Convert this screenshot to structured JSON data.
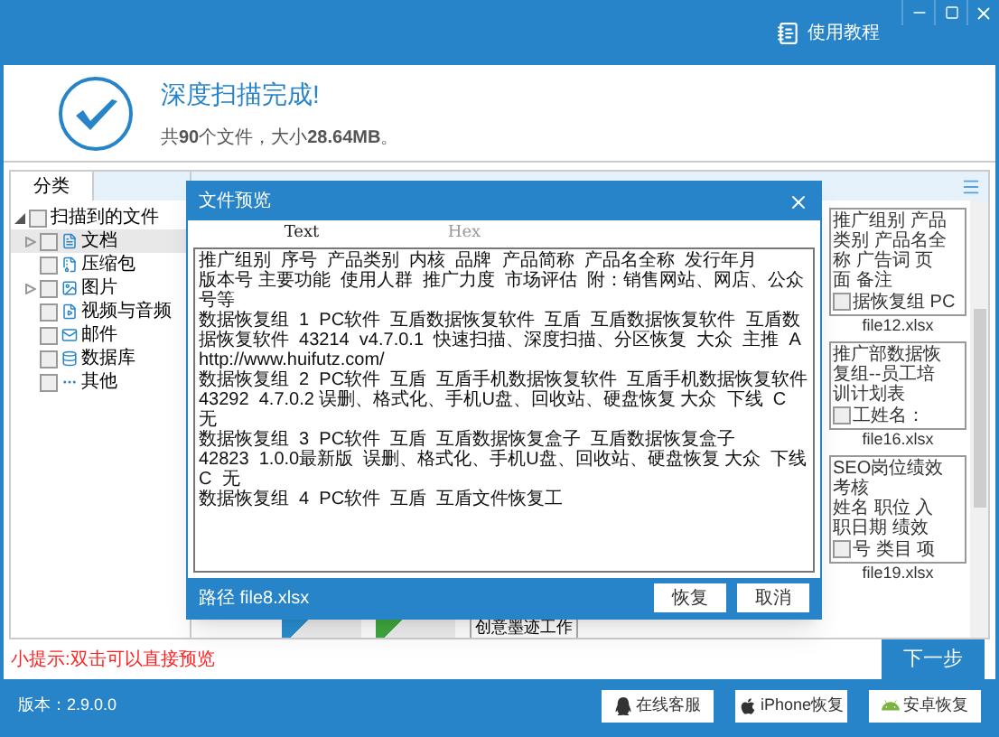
{
  "toolbar": {
    "help": "使用教程"
  },
  "summary": {
    "title": "深度扫描完成!",
    "detail": "共**90**个文件，大小**28.64MB**。"
  },
  "sidebar": {
    "tab": "分类",
    "root": {
      "label": "扫描到的文件",
      "checked": false,
      "expanded": true,
      "children": [
        {
          "label": "文档",
          "kind": "doc",
          "checked": false,
          "expanded": false,
          "selected": true
        },
        {
          "label": "压缩包",
          "kind": "zip",
          "checked": false,
          "selected": false
        },
        {
          "label": "图片",
          "kind": "image",
          "checked": false,
          "expanded": false,
          "selected": false
        },
        {
          "label": "视频与音频",
          "kind": "video",
          "checked": false,
          "selected": false
        },
        {
          "label": "邮件",
          "kind": "mail",
          "checked": false,
          "selected": false
        },
        {
          "label": "数据库",
          "kind": "db",
          "checked": false,
          "selected": false
        },
        {
          "label": "其他",
          "kind": "other",
          "checked": false,
          "selected": false
        }
      ]
    }
  },
  "files": [
    {
      "preview": [
        "推广组别 产品",
        "类别 产品名全",
        "称 广告词 页",
        "面 备注"
      ],
      "preview_end": "据恢复组 PC",
      "name": "file12.xlsx",
      "checked": false
    },
    {
      "preview": [
        "推广部数据恢",
        "复组--员工培",
        "训计划表"
      ],
      "preview_end": "工姓名：",
      "name": "file16.xlsx",
      "checked": false
    },
    {
      "preview": [
        "SEO岗位绩效",
        "考核",
        "姓名 职位 入",
        "职日期 绩效"
      ],
      "preview_end": "号 类目 项",
      "name": "file19.xlsx",
      "checked": false
    }
  ],
  "partial_files": [
    {
      "kind": "docx"
    },
    {
      "kind": "xlsx"
    },
    {
      "kind": "card",
      "preview": "创意墨迹工作"
    }
  ],
  "hint": "小提示:双击可以直接预览",
  "next_button": "下一步",
  "dialog": {
    "title": "文件预览",
    "tabs": [
      {
        "label": "Text",
        "selected": true
      },
      {
        "label": "Hex",
        "selected": false
      }
    ],
    "lines": [
      "推广组别  序号  产品类别  内核  品牌  产品简称  产品名全称  发行年月",
      "版本号 主要功能  使用人群  推广力度  市场评估  附：销售网站、网店、公众号等",
      "数据恢复组  1  PC软件  互盾数据恢复软件  互盾  互盾数据恢复软件  互盾数据恢复软件  43214  v4.7.0.1  快速扫描、深度扫描、分区恢复  大众  主推  A",
      "http://www.huifutz.com/",
      "数据恢复组  2  PC软件  互盾  互盾手机数据恢复软件  互盾手机数据恢复软件",
      "43292  4.7.0.2 误删、格式化、手机U盘、回收站、硬盘恢复 大众  下线  C  无",
      "数据恢复组  3  PC软件  互盾  互盾数据恢复盒子  互盾数据恢复盒子",
      "42823  1.0.0最新版  误删、格式化、手机U盘、回收站、硬盘恢复 大众  下线  C  无",
      "数据恢复组  4  PC软件  互盾  互盾文件恢复工"
    ],
    "path": "路径 file8.xlsx",
    "buttons": [
      "恢复",
      "取消"
    ]
  },
  "footer": {
    "version": "版本：2.9.0.0",
    "buttons": [
      {
        "kind": "qq",
        "label": "在线客服"
      },
      {
        "kind": "apple",
        "label": "iPhone恢复"
      },
      {
        "kind": "android",
        "label": "安卓恢复"
      }
    ]
  }
}
